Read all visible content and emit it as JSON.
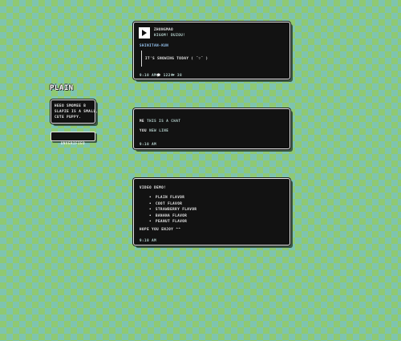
{
  "sidebar": {
    "logo": "PLAIN",
    "description": [
      "HEEO SMOMEE B",
      "SLAPZE IS A SMALL,",
      "CUTE PUPPY."
    ],
    "button_label": "UNVERIFIED"
  },
  "message1": {
    "author": "ZHONGMAO",
    "subtitle": "HIGOM! DUZOU!",
    "reply_to": "SHINITAN-KUN",
    "quote": "IT'S SNOWING TODAY (  ˘▽˘ )",
    "time": "9:10 AM",
    "meta1": "💬 1224",
    "meta2": "♥ 38"
  },
  "message2": {
    "line1_name": "ME",
    "line1_text": "THIS IS A CHAT",
    "line2_name": "YOU",
    "line2_text": "NEW LINE",
    "time": "9:10 AM"
  },
  "message3": {
    "header": "VIDEO DEMO!",
    "items": [
      "PLAIN FLAVOR",
      "COOT FLAVOR",
      "STRAWBERRY FLAVOR",
      "BANANA FLAVOR",
      "PEANUT FLAVOR"
    ],
    "footer": "HOPE YOU ENJOY ^^",
    "time": "9:10 AM"
  },
  "colors": {
    "panel_bg": "#121212",
    "panel_border": "#e8e8e8",
    "bg_check_a": "#7ec4b0",
    "bg_check_b": "#8fc972"
  }
}
